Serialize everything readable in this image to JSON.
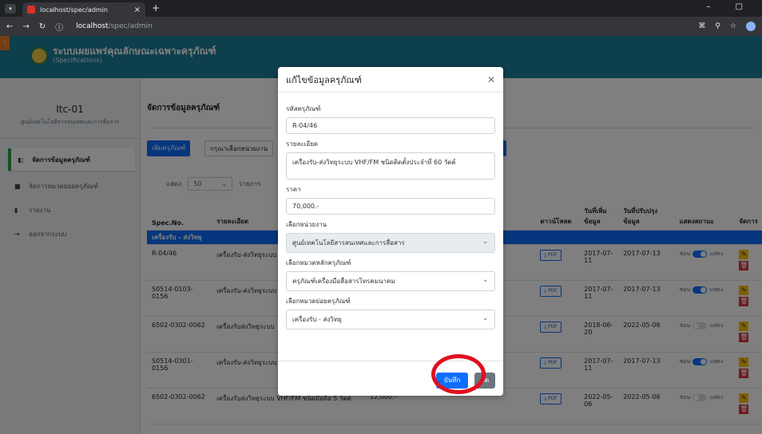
{
  "browser": {
    "tab_title": "localhost/spec/admin",
    "url_host": "localhost",
    "url_path": "/spec/admin"
  },
  "header": {
    "title": "ระบบเผยแพร่คุณลักษณะเฉพาะครุภัณฑ์",
    "subtitle": "(Specifications)"
  },
  "sidebar": {
    "unit_code": "Itc-01",
    "unit_name": "ศูนย์เทคโนโลยีสารสนเทศและการสื่อสาร",
    "items": [
      {
        "label": "จัดการข้อมูลครุภัณฑ์",
        "active": true
      },
      {
        "label": "จัดการหมวดย่อยครุภัณฑ์"
      },
      {
        "label": "รายงาน"
      },
      {
        "label": "ออกจากระบบ"
      }
    ]
  },
  "main": {
    "page_title": "จัดการข้อมูลครุภัณฑ์",
    "add_button": "เพิ่มครุภัณฑ์",
    "pick_unit": "กรุณาเลือกหน่วยงาน",
    "show_label": "แสดง",
    "show_value": "50",
    "show_suffix": "รายการ",
    "columns": [
      "Spec.No.",
      "รายละเอียด",
      "",
      "ดาวน์โหลด",
      "วันที่เพิ่มข้อมูล",
      "วันที่ปรับปรุงข้อมูล",
      "แสดงสถานะ",
      "จัดการ"
    ],
    "group": "เครื่องรับ - ส่งวิทยุ",
    "pdf_label": "PDF",
    "hide_label": "ซ่อน",
    "show_state_label": "แสดง",
    "rows": [
      {
        "spec": "R-04/46",
        "detail": "เครื่องรับ-ส่งวิทยุระบบ",
        "price": "",
        "added": "2017-07-11",
        "updated": "2017-07-13",
        "on": true
      },
      {
        "spec": "S0514-0103-0156",
        "detail": "เครื่องรับ-ส่งวิทยุระบบ",
        "price": "",
        "added": "2017-07-11",
        "updated": "2017-07-13",
        "on": true
      },
      {
        "spec": "6502-0302-0062",
        "detail": "เครื่องรับส่งวิทยุระบบ",
        "price": "",
        "added": "2018-06-20",
        "updated": "2022-05-06",
        "on": false
      },
      {
        "spec": "S0514-0301-0156",
        "detail": "เครื่องรับ-ส่งวิทยุระบบ",
        "price": "",
        "added": "2017-07-11",
        "updated": "2017-07-13",
        "on": true
      },
      {
        "spec": "6502-0302-0062",
        "detail": "เครื่องรับส่งวิทยุระบบ VHF/FM ชนิดมือถือ 5 วัตต์",
        "price": "12,000.-",
        "added": "2022-05-06",
        "updated": "2022-05-06",
        "on": false
      }
    ]
  },
  "modal": {
    "title": "แก้ไขข้อมูลครุภัณฑ์",
    "code_label": "รหัสครุภัณฑ์",
    "code_value": "R-04/46",
    "detail_label": "รายละเอียด",
    "detail_value": "เครื่องรับ-ส่งวิทยุระบบ VHF/FM ชนิดติดตั้งประจำที่ 60 วัตต์",
    "price_label": "ราคา",
    "price_value": "70,000.-",
    "unit_label": "เลือกหน่วยงาน",
    "unit_value": "ศูนย์เทคโนโลยีสารสนเทศและการสื่อสาร",
    "maincat_label": "เลือกหมวดหลักครุภัณฑ์",
    "maincat_value": "ครุภัณฑ์เครื่องมือสื่อสารโทรคมนาคม",
    "subcat_label": "เลือกหมวดย่อยครุภัณฑ์",
    "subcat_value": "เครื่องรับ - ส่งวิทยุ",
    "save_label": "บันทึก",
    "close_label": "ปิด"
  },
  "colors": {
    "header": "#1d7f99",
    "primary": "#0d6efd",
    "highlight": "#e0101f"
  }
}
